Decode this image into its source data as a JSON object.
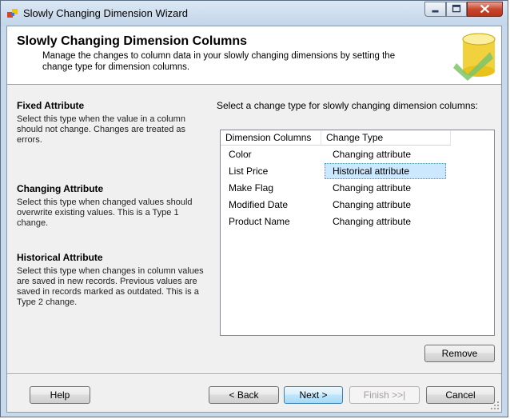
{
  "window": {
    "title": "Slowly Changing Dimension Wizard"
  },
  "header": {
    "title": "Slowly Changing Dimension Columns",
    "description": "Manage the changes to column data in your slowly changing dimensions by setting the change type for dimension columns."
  },
  "help": [
    {
      "heading": "Fixed Attribute",
      "text": "Select this type when the value in a column should not change. Changes are treated as errors."
    },
    {
      "heading": "Changing Attribute",
      "text": "Select this type when changed values should overwrite existing values. This is a Type 1 change."
    },
    {
      "heading": "Historical Attribute",
      "text": "Select this type when changes in column values are saved in new records. Previous values are saved in records marked as outdated. This is a Type 2 change."
    }
  ],
  "main": {
    "instruction": "Select a change type for slowly changing dimension columns:",
    "columns": [
      "Dimension Columns",
      "Change Type"
    ],
    "rows": [
      {
        "column": "Color",
        "type": "Changing attribute",
        "selected": false
      },
      {
        "column": "List Price",
        "type": "Historical attribute",
        "selected": true
      },
      {
        "column": "Make Flag",
        "type": "Changing attribute",
        "selected": false
      },
      {
        "column": "Modified Date",
        "type": "Changing attribute",
        "selected": false
      },
      {
        "column": "Product Name",
        "type": "Changing attribute",
        "selected": false
      }
    ],
    "remove_label": "Remove"
  },
  "footer": {
    "help_label": "Help",
    "back_label": "< Back",
    "next_label": "Next >",
    "finish_label": "Finish >>|",
    "cancel_label": "Cancel"
  },
  "colors": {
    "selection": "#cce8ff",
    "close_button": "#c9472f"
  }
}
